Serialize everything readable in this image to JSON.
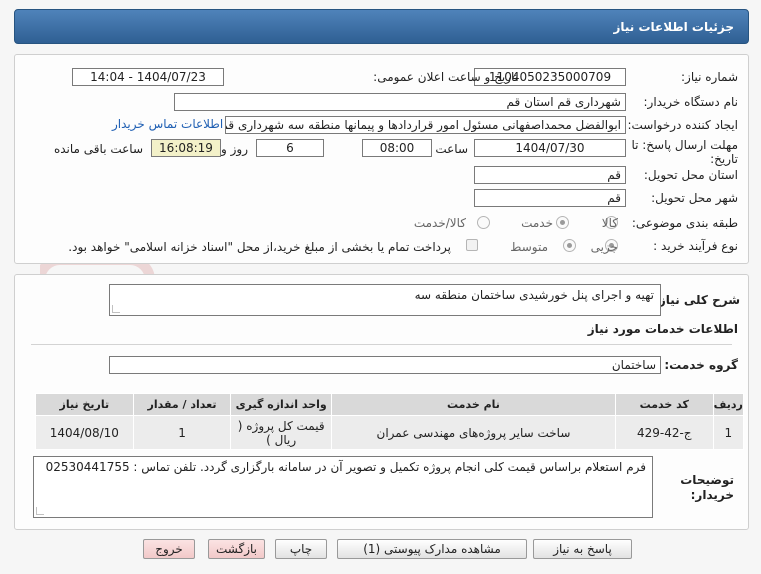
{
  "header": {
    "title": "جزئیات اطلاعات نیاز"
  },
  "form": {
    "need_number_label": "شماره نیاز:",
    "need_number": "1104050235000709",
    "announce_label": "تاریخ و ساعت اعلان عمومی:",
    "announce_value": "1404/07/23 - 14:04",
    "buyer_org_label": "نام دستگاه خریدار:",
    "buyer_org": "شهرداری قم استان قم",
    "requester_label": "ایجاد کننده درخواست:",
    "requester": "ابوالفضل محمداصفهانی مسئول امور قراردادها و پیمانها منطقه سه شهرداری قم",
    "contact_link": "اطلاعات تماس خریدار",
    "deadline_label_1": "مهلت ارسال پاسخ: تا",
    "deadline_label_2": "تاریخ:",
    "deadline_date": "1404/07/30",
    "time_label": "ساعت",
    "deadline_time": "08:00",
    "days_value": "6",
    "days_label": "روز و",
    "remaining_time": "16:08:19",
    "remaining_label": "ساعت باقی مانده",
    "province_label": "استان محل تحویل:",
    "province": "قم",
    "city_label": "شهر محل تحویل:",
    "city": "قم",
    "category_label": "طبقه بندی موضوعی:",
    "category_options": [
      "کالا",
      "خدمت",
      "کالا/خدمت"
    ],
    "category_selected": "خدمت",
    "process_label": "نوع فرآیند خرید :",
    "process_options": [
      "جزیی",
      "متوسط"
    ],
    "process_selected": "جزیی",
    "payment_note": "پرداخت تمام یا بخشی از مبلغ خرید،از محل \"اسناد خزانه اسلامی\" خواهد بود."
  },
  "details": {
    "summary_label": "شرح کلی نیاز:",
    "summary": "تهیه و اجرای پنل خورشیدی ساختمان منطقه سه",
    "services_heading": "اطلاعات خدمات مورد نیاز",
    "service_group_label": "گروه خدمت:",
    "service_group": "ساختمان",
    "table_headers": [
      "ردیف",
      "کد خدمت",
      "نام خدمت",
      "واحد اندازه گیری",
      "تعداد / مقدار",
      "تاریخ نیاز"
    ],
    "table_rows": [
      {
        "row": "1",
        "code": "ج-42-429",
        "name": "ساخت سایر پروژه‌های مهندسی عمران",
        "unit": "قیمت کل پروژه ( ریال )",
        "qty": "1",
        "date": "1404/08/10"
      }
    ],
    "buyer_notes_label_1": "توضیحات",
    "buyer_notes_label_2": "خریدار:",
    "buyer_notes": "فرم استعلام براساس قیمت کلی انجام پروژه تکمیل و تصویر آن در سامانه بارگزاری گردد. تلفن تماس : 02530441755"
  },
  "buttons": {
    "reply": "پاسخ به نیاز",
    "docs": "مشاهده مدارک پیوستی (1)",
    "print": "چاپ",
    "back": "بازگشت",
    "exit": "خروج"
  },
  "watermark": {
    "text": "AriaTender.net"
  },
  "colors": {
    "header": "#3b6ea5",
    "link": "#1f5fb3",
    "highlight": "#f3f1c9"
  }
}
